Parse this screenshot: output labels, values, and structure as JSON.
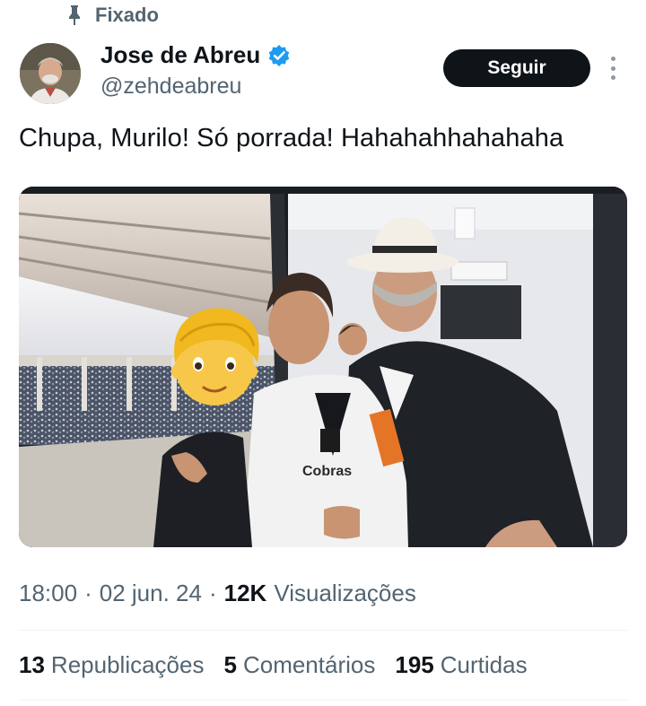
{
  "pinned": {
    "label": "Fixado",
    "icon": "pin-icon"
  },
  "author": {
    "name": "Jose de Abreu",
    "handle": "@zehdeabreu",
    "verified_icon": "verified-badge-icon",
    "verified_color": "#1d9bf0"
  },
  "follow_button": {
    "label": "Seguir"
  },
  "more_icon": "more-options-icon",
  "tweet": {
    "text": "Chupa, Murilo! Só porrada! Hahahahhahahaha",
    "media": {
      "jersey_text_a": "Cobras"
    }
  },
  "meta": {
    "time": "18:00",
    "sep1": "·",
    "date": "02 jun. 24",
    "sep2": "·",
    "views_count": "12K",
    "views_label": "Visualizações"
  },
  "stats": {
    "reposts_count": "13",
    "reposts_label": "Republicações",
    "comments_count": "5",
    "comments_label": "Comentários",
    "likes_count": "195",
    "likes_label": "Curtidas"
  },
  "colors": {
    "text": "#0f1419",
    "secondary": "#536471",
    "button_bg": "#0f1419",
    "divider": "#eff3f4"
  }
}
